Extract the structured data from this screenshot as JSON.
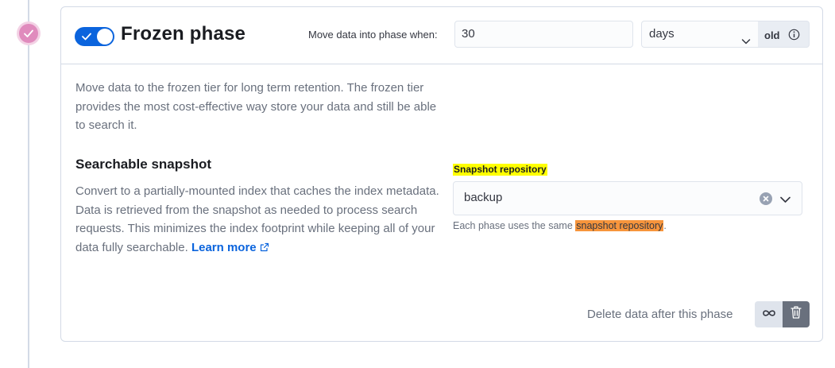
{
  "phase": {
    "title": "Frozen phase",
    "enabled": true,
    "move_label": "Move data into phase when:",
    "min_age_value": "30",
    "min_age_unit": "days",
    "age_append": "old",
    "description": "Move data to the frozen tier for long term retention. The frozen tier provides the most cost-effective way store your data and still be able to search it."
  },
  "searchable_snapshot": {
    "title": "Searchable snapshot",
    "description": "Convert to a partially-mounted index that caches the index metadata. Data is retrieved from the snapshot as needed to process search requests. This minimizes the index footprint while keeping all of your data fully searchable.",
    "learn_more": "Learn more",
    "repo_label": "Snapshot repository",
    "repo_value": "backup",
    "help_prefix": "Each phase uses the same ",
    "help_highlight": "snapshot repository",
    "help_suffix": "."
  },
  "footer": {
    "delete_label": "Delete data after this phase"
  },
  "colors": {
    "accent": "#0b64dd",
    "phase_marker": "#e08bbd",
    "label_highlight": "#ffff00",
    "help_highlight": "#f7953c"
  },
  "icons": [
    "check-icon",
    "chevron-down-icon",
    "info-icon",
    "external-link-icon",
    "clear-icon",
    "infinity-icon",
    "trash-icon"
  ]
}
